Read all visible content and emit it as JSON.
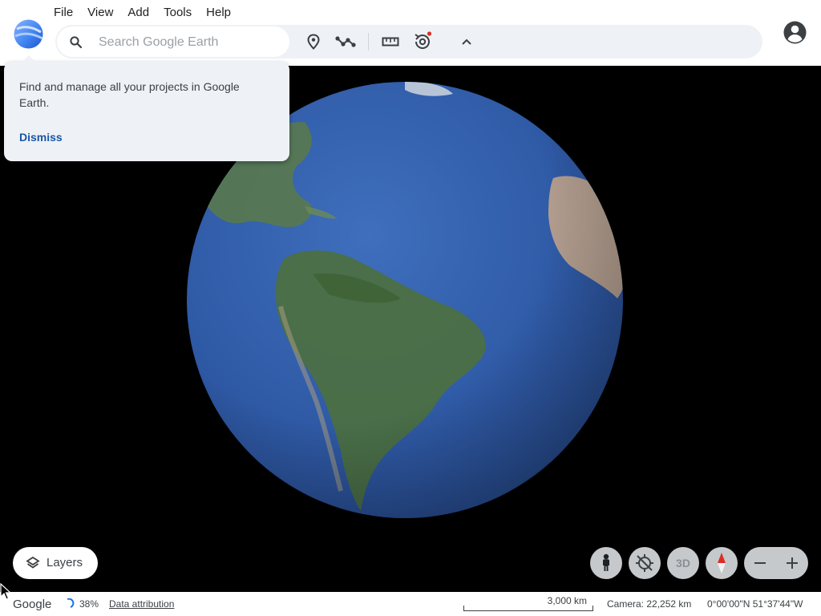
{
  "app": {
    "menu": [
      "File",
      "View",
      "Add",
      "Tools",
      "Help"
    ]
  },
  "search": {
    "placeholder": "Search Google Earth"
  },
  "toolbar": {
    "icons": [
      "place-marker-icon",
      "path-icon",
      "ruler-icon",
      "history-icon",
      "chevron-up-icon"
    ]
  },
  "tooltip": {
    "text": "Find and manage all your projects in Google Earth.",
    "dismiss": "Dismiss"
  },
  "layers": {
    "label": "Layers"
  },
  "controls": {
    "three_d": "3D"
  },
  "status": {
    "brand": "Google",
    "loading": "38%",
    "attribution": "Data attribution",
    "scale": "3,000 km",
    "camera": "Camera: 22,252 km",
    "coordinates": "0°00'00\"N 51°37'44\"W"
  },
  "colors": {
    "accent": "#1a56a6",
    "toolbar_bg": "#eef2f6",
    "ocean": "#2f5aa6",
    "land": "#4c7040",
    "notification_dot": "#d93025"
  }
}
